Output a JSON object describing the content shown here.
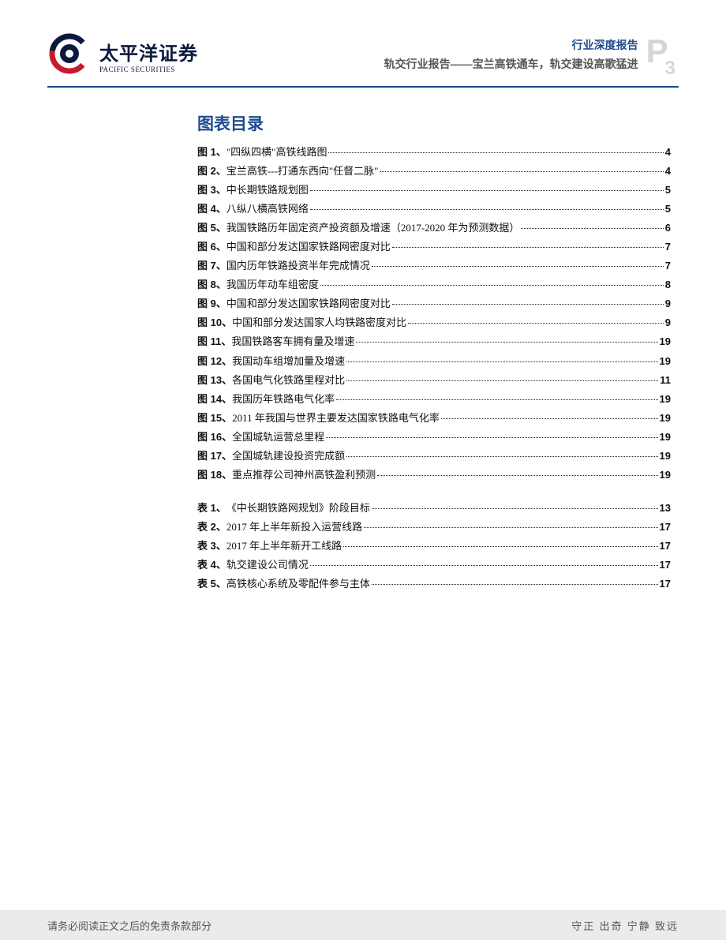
{
  "header": {
    "logo_cn": "太平洋证券",
    "logo_en": "PACIFIC SECURITIES",
    "category": "行业深度报告",
    "subtitle": "轨交行业报告——宝兰高铁通车，轨交建设高歌猛进",
    "page_letter": "P",
    "page_num": "3"
  },
  "toc": {
    "title": "图表目录",
    "figures": [
      {
        "label": "图 1、",
        "text": "\"四纵四横\"高铁线路图",
        "page": "4"
      },
      {
        "label": "图 2、",
        "text": "宝兰高铁---打通东西向\"任督二脉\"",
        "page": "4"
      },
      {
        "label": "图 3、",
        "text": "中长期铁路规划图",
        "page": "5"
      },
      {
        "label": "图 4、",
        "text": "八纵八横高铁网络",
        "page": "5"
      },
      {
        "label": "图 5、",
        "text": "我国铁路历年固定资产投资额及增速（2017-2020 年为预测数据）",
        "page": "6"
      },
      {
        "label": "图 6、",
        "text": "中国和部分发达国家铁路网密度对比",
        "page": "7"
      },
      {
        "label": "图 7、",
        "text": "国内历年铁路投资半年完成情况",
        "page": "7"
      },
      {
        "label": "图 8、",
        "text": "我国历年动车组密度",
        "page": "8"
      },
      {
        "label": "图 9、",
        "text": "中国和部分发达国家铁路网密度对比",
        "page": "9"
      },
      {
        "label": "图 10、",
        "text": "中国和部分发达国家人均铁路密度对比",
        "page": "9"
      },
      {
        "label": "图 11、",
        "text": "我国铁路客车拥有量及增速",
        "page": "19"
      },
      {
        "label": "图 12、",
        "text": "我国动车组增加量及增速",
        "page": "19"
      },
      {
        "label": "图 13、",
        "text": "各国电气化铁路里程对比",
        "page": "11"
      },
      {
        "label": "图 14、",
        "text": "我国历年铁路电气化率",
        "page": "19"
      },
      {
        "label": "图 15、",
        "text": "2011 年我国与世界主要发达国家铁路电气化率",
        "page": "19"
      },
      {
        "label": "图 16、",
        "text": "全国城轨运营总里程",
        "page": "19"
      },
      {
        "label": "图 17、",
        "text": "全国城轨建设投资完成额",
        "page": "19"
      },
      {
        "label": "图 18、",
        "text": "重点推荐公司神州高铁盈利预测",
        "page": "19"
      }
    ],
    "tables": [
      {
        "label": "表 1、",
        "text": "《中长期铁路网规划》阶段目标",
        "page": "13"
      },
      {
        "label": "表 2、",
        "text": "2017 年上半年新投入运营线路",
        "page": "17"
      },
      {
        "label": "表 3、",
        "text": "2017 年上半年新开工线路",
        "page": "17"
      },
      {
        "label": "表 4、",
        "text": "轨交建设公司情况",
        "page": "17"
      },
      {
        "label": "表 5、",
        "text": "高铁核心系统及零配件参与主体",
        "page": "17"
      }
    ]
  },
  "footer": {
    "left": "请务必阅读正文之后的免责条款部分",
    "right": "守正 出奇 宁静 致远"
  }
}
